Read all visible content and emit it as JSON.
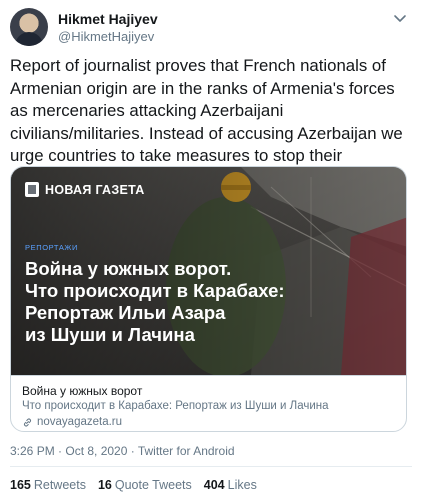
{
  "author": {
    "name": "Hikmet Hajiyev",
    "handle": "@HikmetHajiyev"
  },
  "tweet": {
    "text": "Report of journalist proves that French nationals of Armenian origin are in the ranks of Armenia's forces as mercenaries attacking Azerbaijani civilians/militaries. Instead of accusing Azerbaijan we urge countries to take measures to stop their nationals."
  },
  "card": {
    "brand": "НОВАЯ ГАЗЕТА",
    "section": "РЕПОРТАЖИ",
    "headline_lines": [
      "Война у южных ворот.",
      "Что происходит в Карабахе:",
      "Репортаж Ильи Азара",
      "из Шуши и Лачина"
    ],
    "title": "Война у южных ворот",
    "description": "Что происходит в Карабахе: Репортаж из Шуши и Лачина",
    "domain": "novayagazeta.ru"
  },
  "timestamp": "3:26 PM · Oct 8, 2020 · Twitter for Android",
  "stats": {
    "retweets_count": "165",
    "retweets_label": "Retweets",
    "quotes_count": "16",
    "quotes_label": "Quote Tweets",
    "likes_count": "404",
    "likes_label": "Likes"
  },
  "colors": {
    "link_blue": "#1da1f2",
    "section_blue": "#5aa1ff",
    "secondary_text": "#657786"
  }
}
